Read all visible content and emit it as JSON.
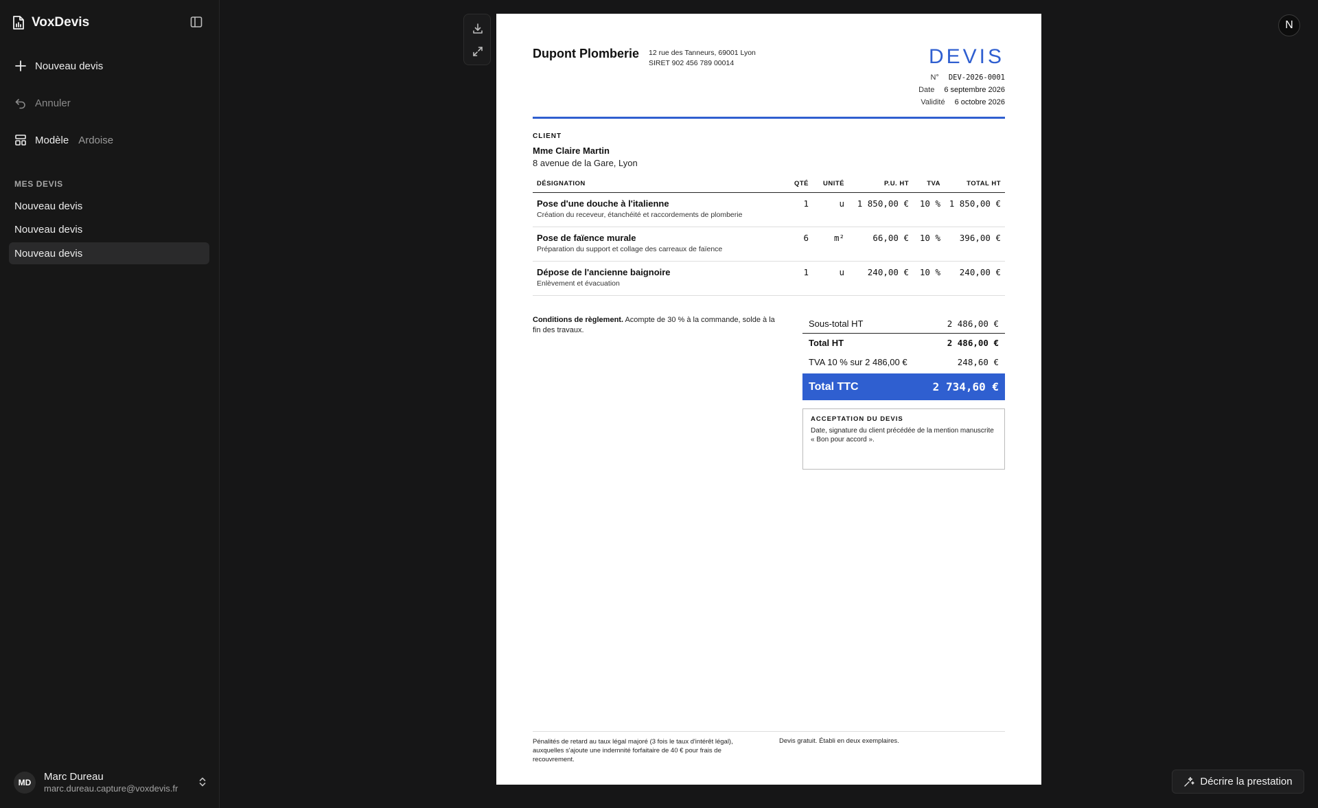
{
  "app": {
    "name": "VoxDevis"
  },
  "sidebar": {
    "new_quote": "Nouveau devis",
    "undo": "Annuler",
    "template_label": "Modèle",
    "template_value": "Ardoise",
    "section_title": "MES DEVIS",
    "quotes": [
      {
        "label": "Nouveau devis"
      },
      {
        "label": "Nouveau devis"
      },
      {
        "label": "Nouveau devis"
      }
    ],
    "user": {
      "initials": "MD",
      "name": "Marc Dureau",
      "email": "marc.dureau.capture@voxdevis.fr"
    }
  },
  "topbar": {
    "avatar_initial": "N"
  },
  "document": {
    "company_name": "Dupont Plomberie",
    "company_address": "12 rue des Tanneurs, 69001 Lyon",
    "company_siret": "SIRET 902 456 789 00014",
    "doc_type": "DEVIS",
    "meta": {
      "number_label": "N°",
      "number": "DEV-2026-0001",
      "date_label": "Date",
      "date": "6 septembre 2026",
      "validity_label": "Validité",
      "validity": "6 octobre 2026"
    },
    "client_label": "CLIENT",
    "client_name": "Mme Claire Martin",
    "client_address": "8 avenue de la Gare, Lyon",
    "columns": {
      "designation": "DÉSIGNATION",
      "qty": "QTÉ",
      "unit": "UNITÉ",
      "unit_price": "P.U. HT",
      "vat": "TVA",
      "total": "TOTAL HT"
    },
    "lines": [
      {
        "title": "Pose d'une douche à l'italienne",
        "desc": "Création du receveur, étanchéité et raccordements de plomberie",
        "qty": "1",
        "unit": "u",
        "unit_price": "1 850,00 €",
        "vat": "10 %",
        "total": "1 850,00 €"
      },
      {
        "title": "Pose de faïence murale",
        "desc": "Préparation du support et collage des carreaux de faïence",
        "qty": "6",
        "unit": "m²",
        "unit_price": "66,00 €",
        "vat": "10 %",
        "total": "396,00 €"
      },
      {
        "title": "Dépose de l'ancienne baignoire",
        "desc": "Enlèvement et évacuation",
        "qty": "1",
        "unit": "u",
        "unit_price": "240,00 €",
        "vat": "10 %",
        "total": "240,00 €"
      }
    ],
    "conditions_label": "Conditions de règlement.",
    "conditions_text": "Acompte de 30 % à la commande, solde à la fin des travaux.",
    "totals": {
      "subtotal_label": "Sous-total HT",
      "subtotal": "2 486,00 €",
      "total_ht_label": "Total HT",
      "total_ht": "2 486,00 €",
      "vat_label": "TVA 10 % sur 2 486,00 €",
      "vat": "248,60 €",
      "ttc_label": "Total TTC",
      "ttc": "2 734,60 €"
    },
    "acceptance_title": "ACCEPTATION DU DEVIS",
    "acceptance_text": "Date, signature du client précédée de la mention manuscrite « Bon pour accord ».",
    "footer_left": "Pénalités de retard au taux légal majoré (3 fois le taux d'intérêt légal), auxquelles s'ajoute une indemnité forfaitaire de 40 € pour frais de recouvrement.",
    "footer_right": "Devis gratuit. Établi en deux exemplaires."
  },
  "actions": {
    "describe": "Décrire la prestation"
  }
}
